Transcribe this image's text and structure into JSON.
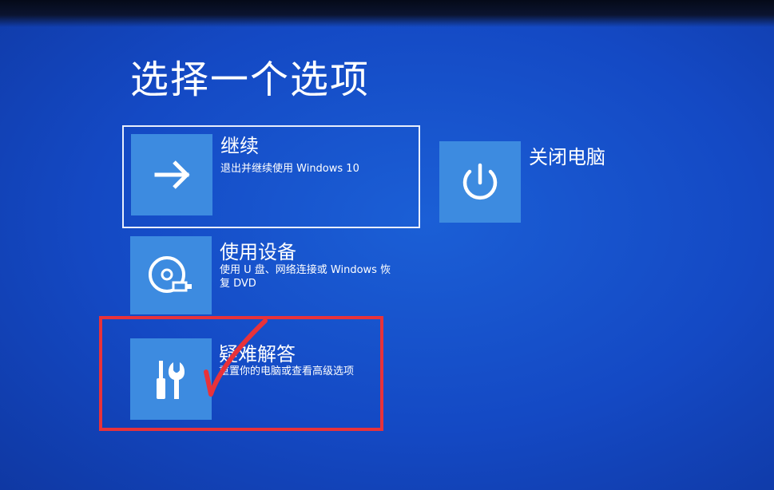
{
  "screen": {
    "title": "选择一个选项",
    "background_color": "#1449c4",
    "tile_color": "#3d8be0",
    "annotation_color": "#e8323a"
  },
  "options": {
    "continue": {
      "label": "继续",
      "description": "退出并继续使用 Windows 10",
      "icon": "arrow-right-icon",
      "selected": true
    },
    "use_device": {
      "label": "使用设备",
      "description_line1": "使用 U 盘、网络连接或 Windows 恢",
      "description_line2": "复 DVD",
      "icon": "disc-usb-icon"
    },
    "troubleshoot": {
      "label": "疑难解答",
      "description": "重置你的电脑或查看高级选项",
      "icon": "tools-icon",
      "annotated": true
    },
    "shutdown": {
      "label": "关闭电脑",
      "icon": "power-icon"
    }
  },
  "annotation": {
    "shape": "red-box-with-checkmark",
    "target": "troubleshoot"
  }
}
